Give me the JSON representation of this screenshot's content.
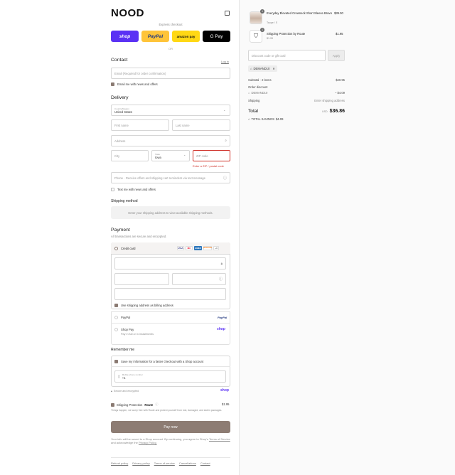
{
  "brand": {
    "logo": "NOOD"
  },
  "express": {
    "label": "Express checkout",
    "buttons": [
      {
        "name": "shop",
        "label": "shop",
        "bg": "#5a31f4",
        "fg": "#ffffff"
      },
      {
        "name": "paypal",
        "label": "PayPal",
        "bg": "#ffc439",
        "fg": "#253b80"
      },
      {
        "name": "amazonpay",
        "label": "amazon pay",
        "bg": "#ffd814",
        "fg": "#111111"
      },
      {
        "name": "gpay",
        "label": "G Pay",
        "bg": "#000000",
        "fg": "#ffffff"
      }
    ],
    "or": "OR"
  },
  "contact": {
    "heading": "Contact",
    "login": "Log in",
    "email_placeholder": "Email (Required for order confirmation)",
    "news_label": "Email me with news and offers"
  },
  "delivery": {
    "heading": "Delivery",
    "country_label": "Country/Region",
    "country_value": "United States",
    "first_name": "First name",
    "last_name": "Last name",
    "address": "Address",
    "city": "City",
    "state_label": "State",
    "state_value": "Iowa",
    "zip": "ZIP code",
    "zip_error": "Enter a ZIP / postal code",
    "phone": "Phone · Receive offers and shipping cart reminders via text message",
    "text_label": "Text me with news and offers"
  },
  "shipping": {
    "heading": "Shipping method",
    "placeholder": "Enter your shipping address to view available shipping methods."
  },
  "payment": {
    "heading": "Payment",
    "subtitle": "All transactions are secure and encrypted.",
    "credit_card": "Credit card",
    "card_brands": [
      "VISA",
      "MC",
      "AMEX",
      "DISCOVER",
      "+3"
    ],
    "billing_same": "Use shipping address as billing address",
    "paypal": "PayPal",
    "paypal_brand": "PayPal",
    "shoppay": "Shop Pay",
    "shoppay_sub": "Pay in full or in installments",
    "shoppay_brand": "shop"
  },
  "remember": {
    "heading": "Remember me",
    "save_label": "Save my information for a faster checkout with a Shop account",
    "mobile_label": "Mobile phone number",
    "mobile_value": "+1",
    "secure": "Secure and encrypted",
    "shop_brand": "shop"
  },
  "protection": {
    "label": "Shipping Protection",
    "brand": "Route",
    "price": "$1.95",
    "desc": "Things happen, we worry free with Route and protect yourself from lost, damaged, and stolen packages."
  },
  "pay_now": "Pay now",
  "legal": {
    "text": "Your info will be saved to a Shop account. By continuing, you agree to Shop's",
    "tos": "Terms of Service",
    "and": "and acknowledge the",
    "privacy": "Privacy Policy."
  },
  "footer": [
    "Refund policy",
    "Privacy policy",
    "Terms of service",
    "Cancellations",
    "Contact"
  ],
  "cart": {
    "items": [
      {
        "qty": "1",
        "title": "Everyday Elevated Crewneck Short Sleeve Bravo",
        "variant": "Taupe / S",
        "price": "$39.00"
      },
      {
        "qty": "1",
        "title": "Shipping Protection by Route",
        "variant": "$1.95",
        "price": "$1.95"
      }
    ],
    "discount_placeholder": "Discount code or gift card",
    "apply": "Apply",
    "applied_code": "DEMAND10",
    "subtotal_label": "Subtotal · 2 items",
    "subtotal_value": "$40.95",
    "order_discount_label": "Order discount",
    "order_discount_code": "DEMAND10",
    "order_discount_value": "– $4.09",
    "shipping_label": "Shipping",
    "shipping_value": "Enter shipping address",
    "total_label": "Total",
    "currency": "USD",
    "total_value": "$36.86",
    "savings_label": "TOTAL SAVINGS",
    "savings_value": "$4.09"
  },
  "colors": {
    "accent": "#8d7c73",
    "error": "#d0342c"
  }
}
